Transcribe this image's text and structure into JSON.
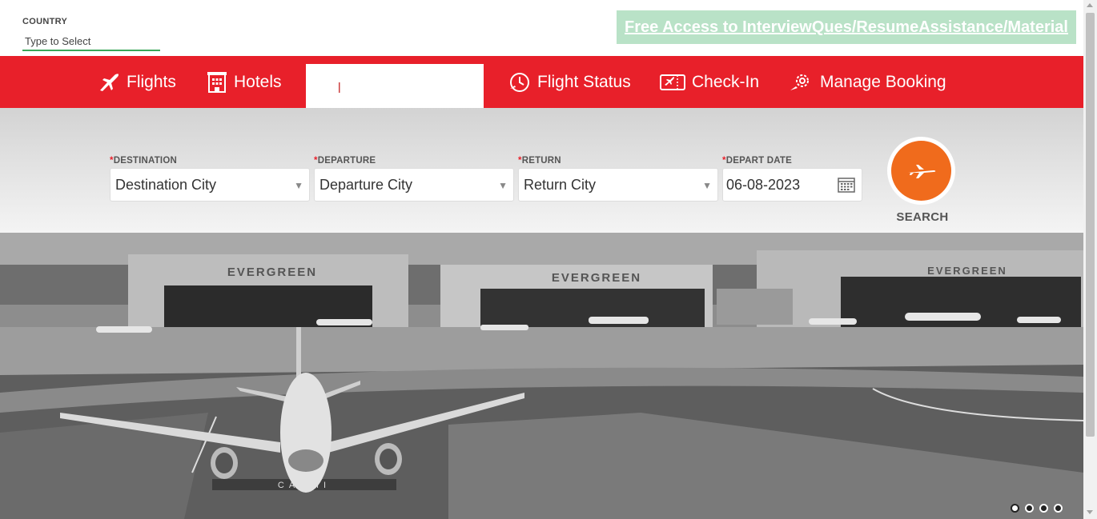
{
  "country": {
    "label": "COUNTRY",
    "placeholder": "Type to Select"
  },
  "promo": {
    "link_text": "Free Access to InterviewQues/ResumeAssistance/Material"
  },
  "nav": {
    "flights": "Flights",
    "hotels": "Hotels",
    "flight_status": "Flight Status",
    "check_in": "Check-In",
    "manage_booking": "Manage Booking"
  },
  "form": {
    "required_marker": "*",
    "destination": {
      "label": "DESTINATION",
      "value": "Destination City"
    },
    "departure": {
      "label": "DEPARTURE",
      "value": "Departure City"
    },
    "return": {
      "label": "RETURN",
      "value": "Return City"
    },
    "depart_date": {
      "label": "DEPART DATE",
      "value": "06-08-2023"
    },
    "search_label": "SEARCH"
  },
  "hero": {
    "hangar_sign": "EVERGREEN",
    "runway_sign": "CAT II",
    "slides_total": 4,
    "active_slide": 1
  },
  "colors": {
    "brand_red": "#e8202a",
    "search_orange": "#f06b1c",
    "promo_bg": "#b9e2c7",
    "input_underline": "#3aa65a"
  }
}
